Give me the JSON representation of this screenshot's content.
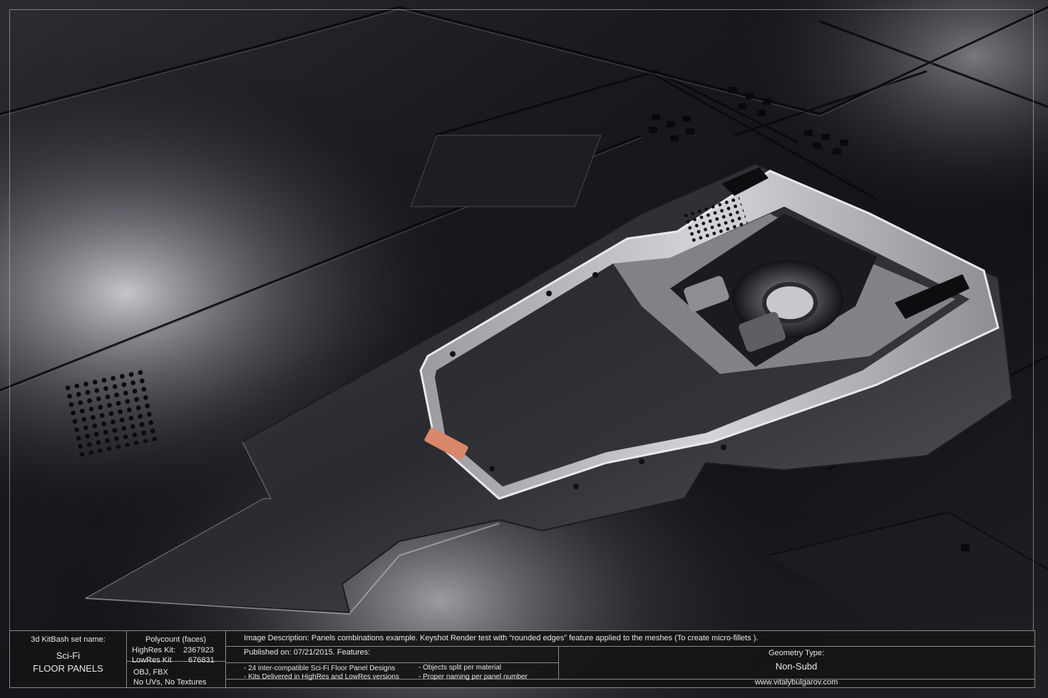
{
  "kitbash": {
    "set_label": "3d KitBash set name:",
    "name_line1": "Sci-Fi",
    "name_line2": "FLOOR PANELS"
  },
  "polycount": {
    "label": "Polycount (faces)",
    "highres_label": "HighRes Kit:",
    "highres_value": "2367923",
    "lowres_label": "LowRes Kit",
    "lowres_value": "676831"
  },
  "formats": {
    "line1": "OBJ, FBX",
    "line2": "No UVs, No Textures"
  },
  "description": "Image Description: Panels combinations example. Keyshot Render test with “rounded edges” feature applied to the meshes (To create micro-fillets ).",
  "published": "Published on: 07/21/2015. Features:",
  "features": {
    "f1": "-   24 inter-compatible Sci-Fi Floor Panel Designs",
    "f2": "-   Kits Delivered in HighRes and LowRes versions",
    "f3": "-   Objects split per material",
    "f4": "-   Proper naming per panel number"
  },
  "geometry": {
    "label": "Geometry Type:",
    "value": "Non-Subd"
  },
  "website": "www.vitalybulgarov.com",
  "colors": {
    "background": "#0c0c0e",
    "panel_dark": "#1a1a1e",
    "panel_mid": "#3a3b40",
    "metal_highlight": "#e6e8ec",
    "copper_plate": "#d9876a"
  }
}
